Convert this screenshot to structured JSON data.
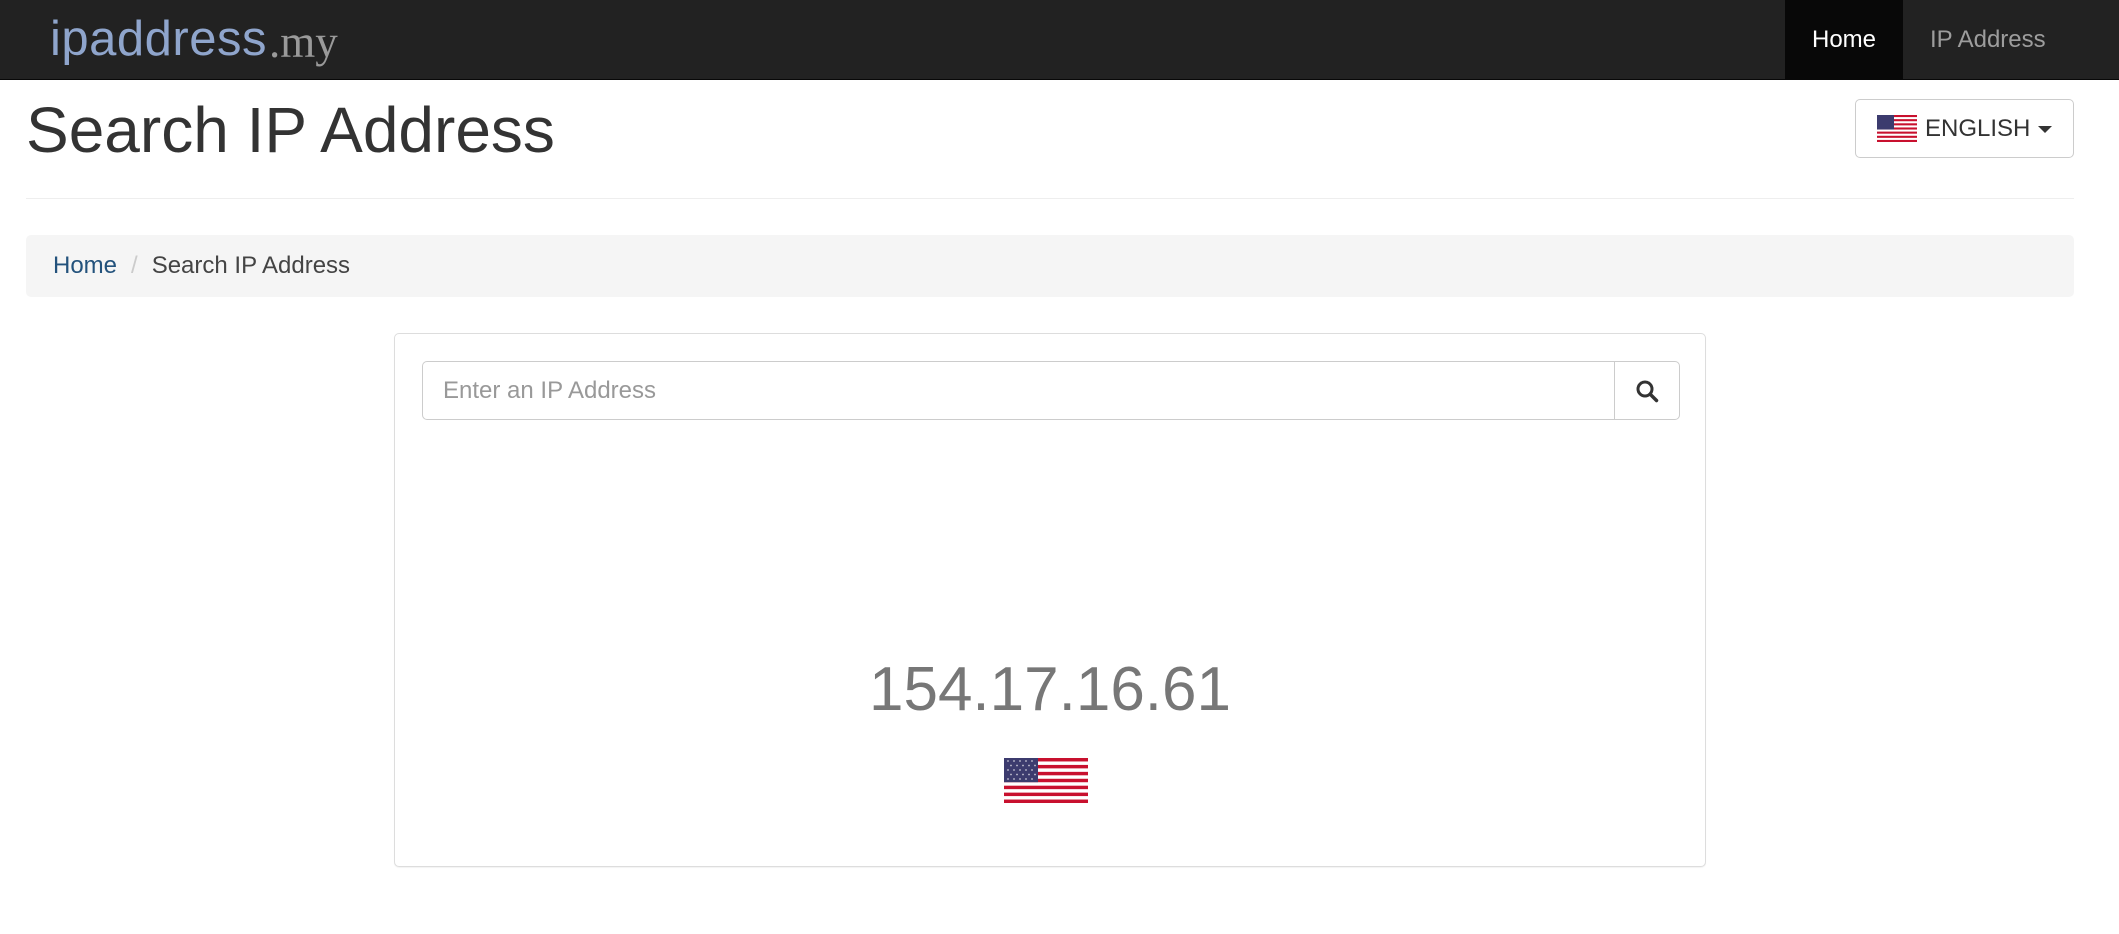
{
  "navbar": {
    "brand_main": "ipaddress",
    "brand_tld": ".my",
    "items": [
      {
        "label": "Home",
        "active": true
      },
      {
        "label": "IP Address",
        "active": false
      }
    ]
  },
  "header": {
    "title": "Search IP Address",
    "language_button": {
      "label": "ENGLISH",
      "flag_icon": "us-flag-icon"
    }
  },
  "breadcrumb": {
    "items": [
      {
        "label": "Home",
        "link": true
      },
      {
        "label": "Search IP Address",
        "link": false
      }
    ],
    "separator": "/"
  },
  "search": {
    "placeholder": "Enter an IP Address",
    "value": "",
    "button_icon": "search-icon"
  },
  "result": {
    "ip": "154.17.16.61",
    "country_flag_icon": "us-flag-icon"
  },
  "colors": {
    "navbar_bg": "#222222",
    "nav_active_bg": "#080808",
    "brand_blue": "#8fa5cc",
    "link_blue": "#23527c",
    "ip_text": "#777777",
    "breadcrumb_bg": "#f5f5f5"
  }
}
